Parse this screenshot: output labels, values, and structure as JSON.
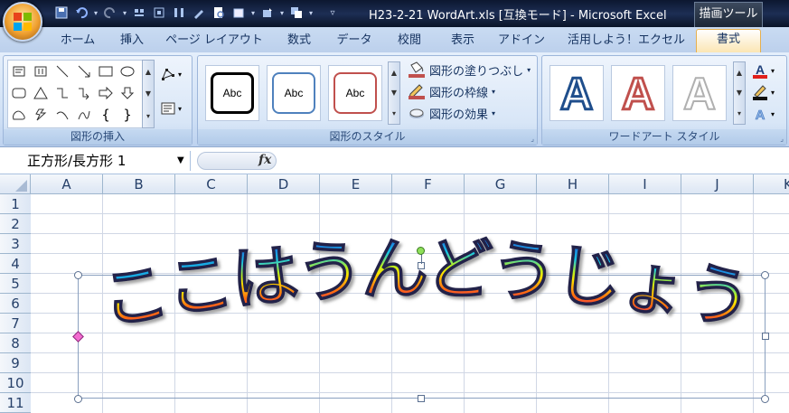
{
  "titlebar": {
    "title": "H23-2-21 WordArt.xls  [互換モード] - Microsoft Excel",
    "context_label": "描画ツール"
  },
  "tabs": [
    "ホーム",
    "挿入",
    "ページ レイアウト",
    "数式",
    "データ",
    "校閲",
    "表示",
    "アドイン",
    "活用しよう！エクセル",
    "書式"
  ],
  "active_tab": "書式",
  "ribbon": {
    "group_insert_shapes": "図形の挿入",
    "group_shape_styles": "図形のスタイル",
    "group_wordart_styles": "ワードアート スタイル",
    "style_sample_label": "Abc",
    "fill_label": "図形の塗りつぶし",
    "outline_label": "図形の枠線",
    "effects_label": "図形の効果",
    "wordart_sample": "A"
  },
  "formula_bar": {
    "name_box": "正方形/長方形 1",
    "fx_label": "fx",
    "formula": ""
  },
  "columns": [
    "A",
    "B",
    "C",
    "D",
    "E",
    "F",
    "G",
    "H",
    "I",
    "J",
    "K"
  ],
  "rows": [
    "1",
    "2",
    "3",
    "4",
    "5",
    "6",
    "7",
    "8",
    "9",
    "10",
    "11"
  ],
  "wordart": {
    "text": "ここはうんどうじょう",
    "chars": [
      "こ",
      "こ",
      "は",
      "う",
      "ん",
      "ど",
      "う",
      "じ",
      "ょ",
      "う"
    ]
  },
  "colors": {
    "ribbon_bg": "#d6e5f7",
    "title_bg": "#1d2e54",
    "active_tab_border": "#e6b04f",
    "gradient_top": "#1f2fd6",
    "gradient_mid": "#ffe400",
    "gradient_bottom": "#e01c8a"
  }
}
